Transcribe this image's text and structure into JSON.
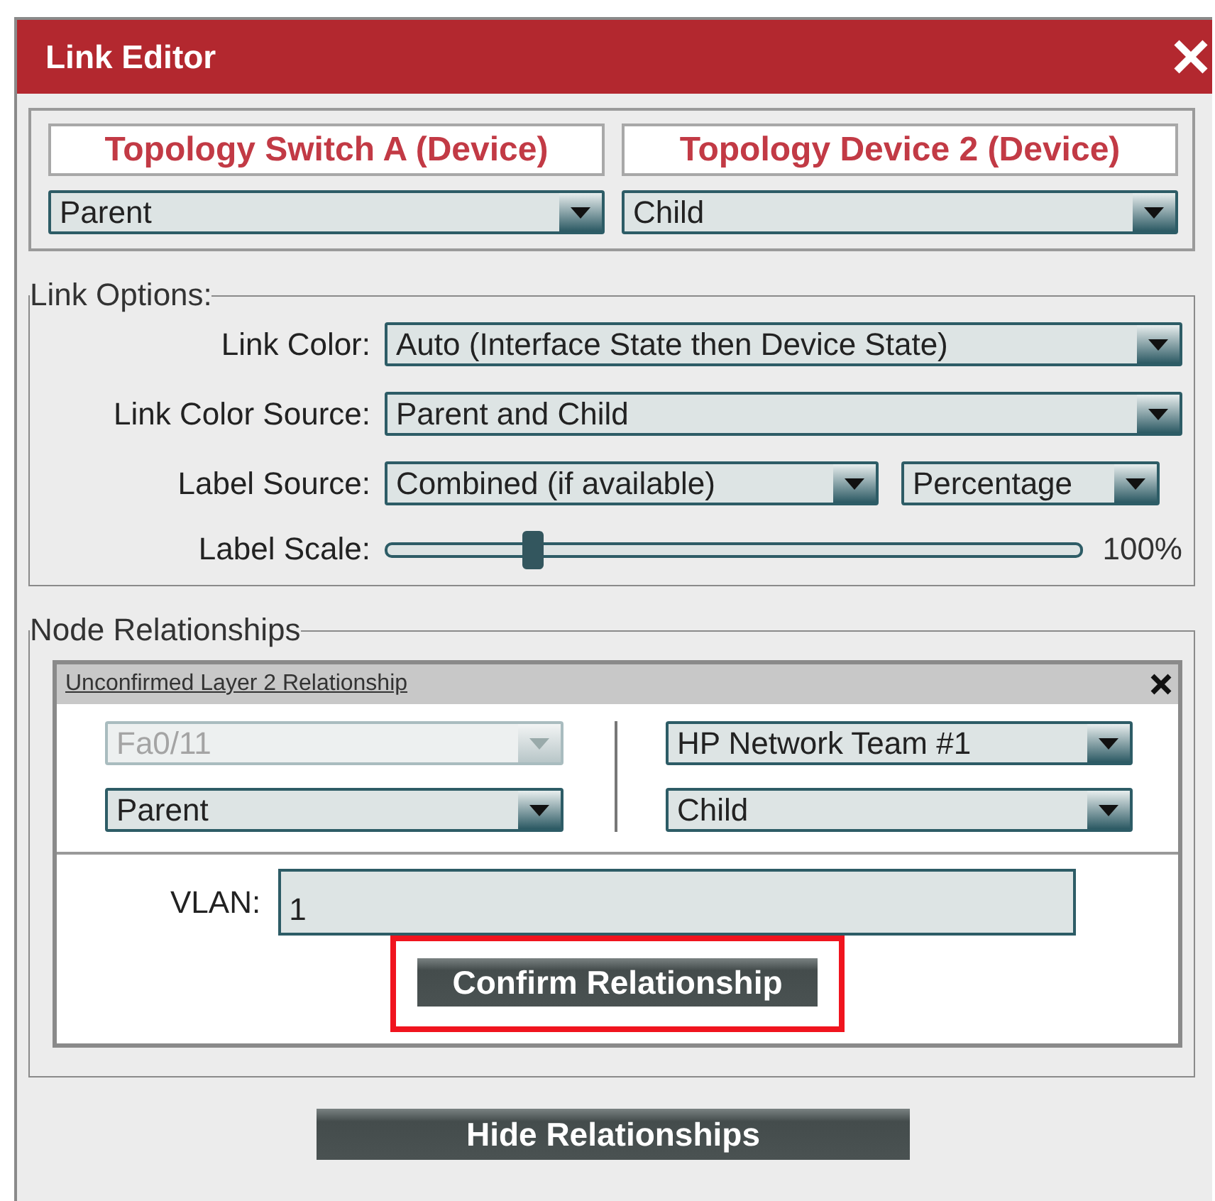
{
  "window": {
    "title": "Link Editor"
  },
  "endpoints": [
    {
      "name": "Topology Switch A (Device)",
      "role": "Parent"
    },
    {
      "name": "Topology Device 2 (Device)",
      "role": "Child"
    }
  ],
  "link_options": {
    "legend": "Link Options:",
    "rows": [
      {
        "kind": "select",
        "label": "Link Color:",
        "value": "Auto (Interface State then Device State)"
      },
      {
        "kind": "select",
        "label": "Link Color Source:",
        "value": "Parent and Child"
      },
      {
        "kind": "double_select",
        "label": "Label Source:",
        "value": "Combined (if available)",
        "value_2": "Percentage"
      },
      {
        "kind": "slider",
        "label": "Label Scale:",
        "level": 0.21,
        "reading": "100%"
      }
    ]
  },
  "node_relationships": {
    "legend": "Node Relationships",
    "panel": {
      "title": "Unconfirmed Layer 2 Relationship",
      "columns": [
        {
          "selects": [
            {
              "value": "Fa0/11",
              "disabled": true
            },
            {
              "value": "Parent",
              "disabled": false
            }
          ]
        },
        {
          "selects": [
            {
              "value": "HP Network Team #1",
              "disabled": false
            },
            {
              "value": "Child",
              "disabled": false
            }
          ]
        }
      ],
      "vlan": {
        "label": "VLAN:",
        "value": "1"
      },
      "confirm_button": {
        "label": "Confirm Relationship",
        "highlighted": true
      }
    }
  },
  "hide_button": {
    "label": "Hide Relationships"
  }
}
